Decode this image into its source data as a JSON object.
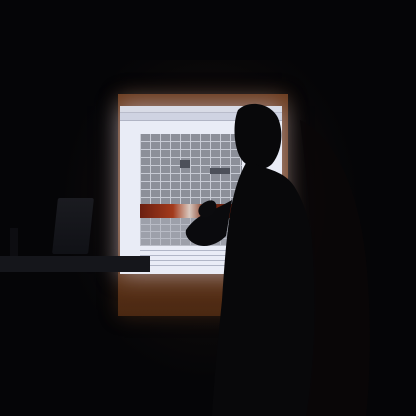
{
  "scene": {
    "subject": "presenter",
    "projector_image": "dark-grid-with-heatmap-band",
    "colors": {
      "background": "#050507",
      "screen": "#e9ecf6",
      "frame": "#6a3a1c",
      "heat_band": "#a33a1c",
      "silhouette": "#08080a"
    }
  }
}
